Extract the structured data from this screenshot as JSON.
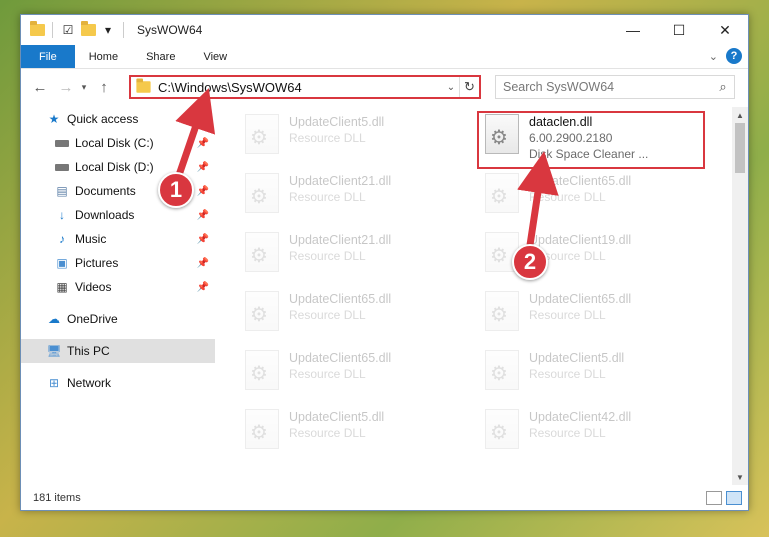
{
  "window": {
    "title": "SysWOW64",
    "controls": [
      "—",
      "☐",
      "✕"
    ]
  },
  "ribbon": {
    "tabs": [
      "File",
      "Home",
      "Share",
      "View"
    ],
    "help": "?"
  },
  "address_bar": {
    "path": "C:\\Windows\\SysWOW64",
    "search_placeholder": "Search SysWOW64"
  },
  "nav_pane": {
    "items": [
      {
        "label": "Quick access",
        "icon": "star-icon"
      },
      {
        "label": "Local Disk (C:)",
        "icon": "drive-icon",
        "pinned": true
      },
      {
        "label": "Local Disk (D:)",
        "icon": "drive-icon",
        "pinned": true
      },
      {
        "label": "Documents",
        "icon": "documents-icon",
        "pinned": true
      },
      {
        "label": "Downloads",
        "icon": "downloads-icon",
        "pinned": true
      },
      {
        "label": "Music",
        "icon": "music-icon",
        "pinned": true
      },
      {
        "label": "Pictures",
        "icon": "pictures-icon",
        "pinned": true
      },
      {
        "label": "Videos",
        "icon": "videos-icon",
        "pinned": true
      },
      {
        "label": "OneDrive",
        "icon": "cloud-icon"
      },
      {
        "label": "This PC",
        "icon": "computer-icon",
        "selected": true
      },
      {
        "label": "Network",
        "icon": "network-icon"
      }
    ]
  },
  "files": [
    {
      "name": "UpdateClient5.dll",
      "type": "Resource DLL",
      "faded": true
    },
    {
      "name": "dataclen.dll",
      "version": "6.00.2900.2180",
      "description": "Disk Space Cleaner ...",
      "highlighted": true
    },
    {
      "name": "UpdateClient21.dll",
      "type": "Resource DLL",
      "faded": true
    },
    {
      "name": "UpdateClient65.dll",
      "type": "Resource DLL",
      "faded": true
    },
    {
      "name": "UpdateClient21.dll",
      "type": "Resource DLL",
      "faded": true
    },
    {
      "name": "UpdateClient19.dll",
      "type": "Resource DLL",
      "faded": true
    },
    {
      "name": "UpdateClient65.dll",
      "type": "Resource DLL",
      "faded": true
    },
    {
      "name": "UpdateClient65.dll",
      "type": "Resource DLL",
      "faded": true
    },
    {
      "name": "UpdateClient65.dll",
      "type": "Resource DLL",
      "faded": true
    },
    {
      "name": "UpdateClient5.dll",
      "type": "Resource DLL",
      "faded": true
    },
    {
      "name": "UpdateClient5.dll",
      "type": "Resource DLL",
      "faded": true
    },
    {
      "name": "UpdateClient42.dll",
      "type": "Resource DLL",
      "faded": true
    }
  ],
  "status": {
    "item_count": "181 items"
  },
  "callouts": {
    "one": "1",
    "two": "2"
  },
  "colors": {
    "accent": "#1979ca",
    "highlight": "#d9373f"
  }
}
